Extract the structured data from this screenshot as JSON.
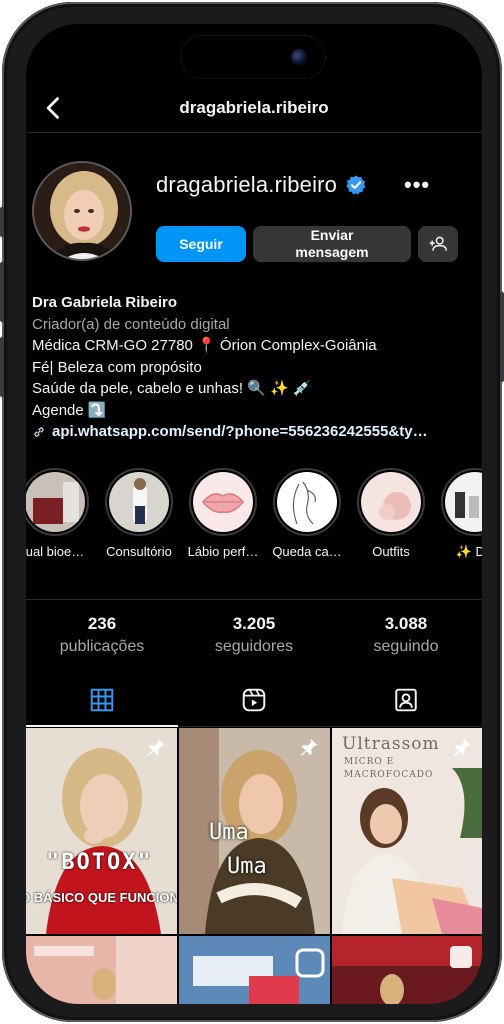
{
  "profile": {
    "username": "dragabriela.ribeiro",
    "display_name": "Dra Gabriela Ribeiro",
    "category": "Criador(a) de conteúdo digital",
    "bio_lines": [
      "Médica CRM-GO 27780 📍 Órion Complex-Goiânia",
      "Fé| Beleza com propósito",
      "Saúde da pele, cabelo e unhas! 🔍 ✨ 💉",
      "Agende ⤵️"
    ],
    "link": "api.whatsapp.com/send/?phone=556236242555&ty…"
  },
  "buttons": {
    "follow": "Seguir",
    "message_line1": "Enviar",
    "message_line2": "mensagem"
  },
  "highlights": [
    {
      "label": "ual bioe…"
    },
    {
      "label": "Consultório"
    },
    {
      "label": "Lábio perf…"
    },
    {
      "label": "Queda ca…"
    },
    {
      "label": "Outfits"
    },
    {
      "label": "✨ Dic"
    }
  ],
  "stats": {
    "posts": {
      "value": "236",
      "label": "publicações"
    },
    "followers": {
      "value": "3.205",
      "label": "seguidores"
    },
    "following": {
      "value": "3.088",
      "label": "seguindo"
    }
  },
  "posts": [
    {
      "line1": "\"BOTOX\"",
      "line2": "O BÁSICO QUE FUNCIONA"
    },
    {
      "line1": "Uma",
      "line2": "Uma"
    },
    {
      "line1": "Ultrassom",
      "line2": "MICRO E MACROFOCADO"
    }
  ],
  "colors": {
    "accent": "#0095f6",
    "background": "#000000",
    "secondary_button": "#363636"
  },
  "icons": [
    "back-arrow-icon",
    "verified-badge-icon",
    "more-options-icon",
    "add-person-icon",
    "link-icon",
    "grid-icon",
    "reels-icon",
    "tagged-icon",
    "pin-icon"
  ]
}
